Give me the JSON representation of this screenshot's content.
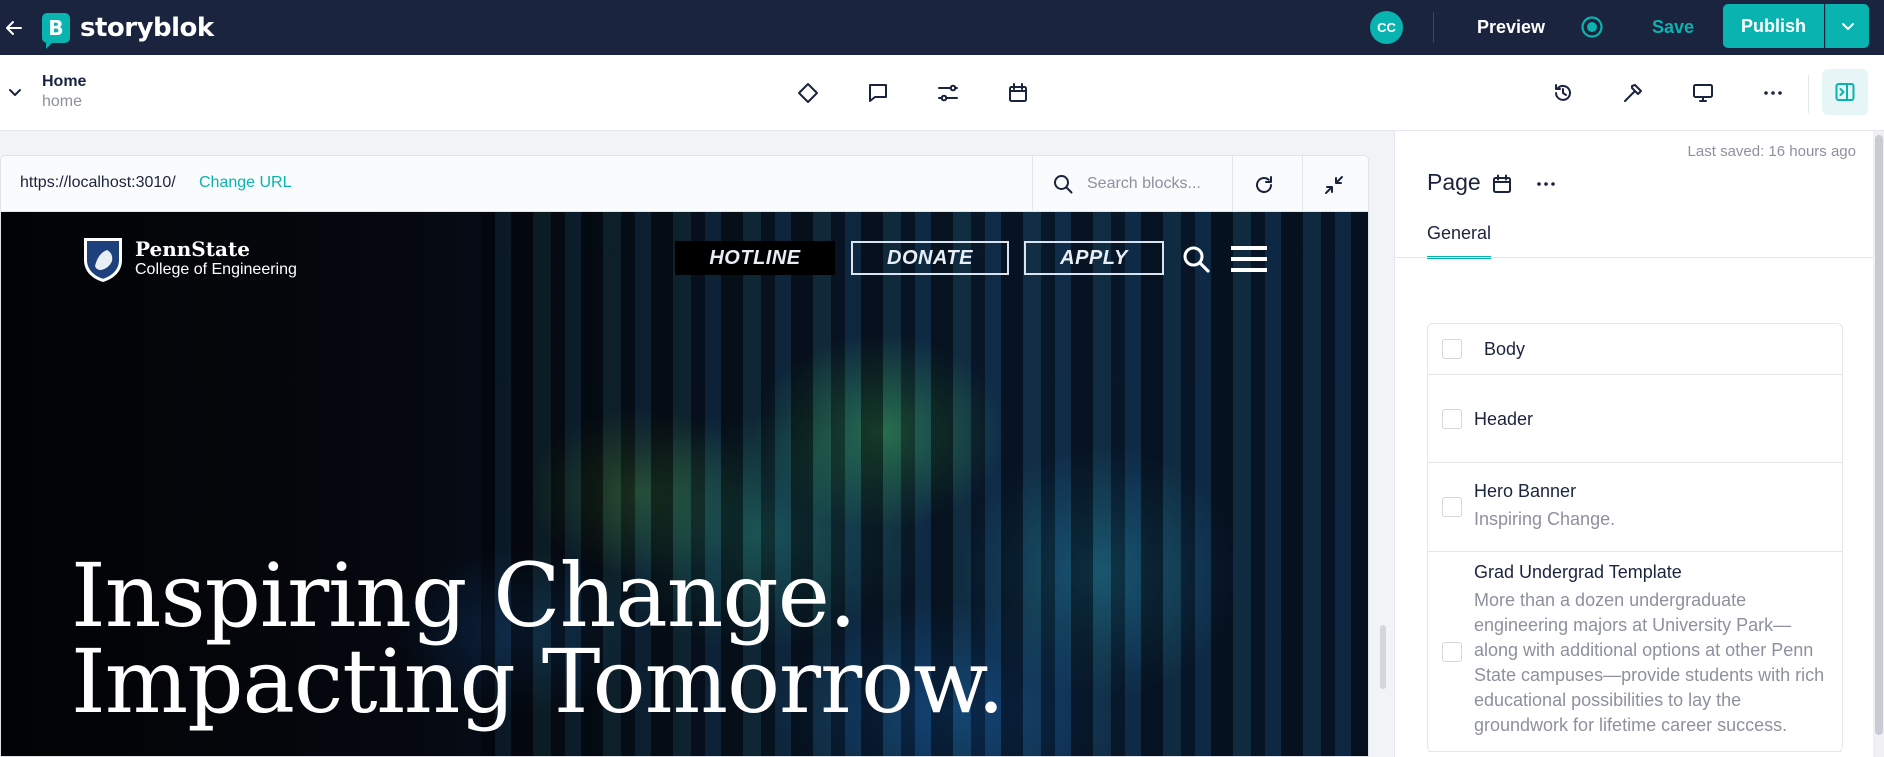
{
  "app": {
    "brand_name": "storyblok",
    "brand_initial": "B",
    "accent_color": "#09b3af",
    "topbar_color": "#1b243f"
  },
  "topbar": {
    "avatar_initials": "CC",
    "preview_label": "Preview",
    "save_label": "Save",
    "publish_label": "Publish"
  },
  "story": {
    "title": "Home",
    "slug": "home"
  },
  "toolbar_icons": [
    "component-icon",
    "comment-icon",
    "settings-sliders-icon",
    "calendar-icon"
  ],
  "right_tools": [
    "history-icon",
    "hammer-icon",
    "monitor-icon",
    "more-icon",
    "sidebar-toggle-icon"
  ],
  "preview": {
    "url": "https://localhost:3010/",
    "change_url_label": "Change URL",
    "search_placeholder": "Search blocks..."
  },
  "site": {
    "logo_name": "PennState",
    "logo_subtitle": "College of Engineering",
    "nav": [
      "HOTLINE",
      "DONATE",
      "APPLY"
    ],
    "hero_line1": "Inspiring Change.",
    "hero_line2": "Impacting Tomorrow."
  },
  "panel": {
    "last_saved": "Last saved: 16 hours ago",
    "title": "Page",
    "tab_general": "General",
    "blocks": [
      {
        "name": "Body",
        "desc": ""
      },
      {
        "name": "Header",
        "desc": ""
      },
      {
        "name": "Hero Banner",
        "desc": "Inspiring Change."
      },
      {
        "name": "Grad Undergrad Template",
        "desc": "More than a dozen undergraduate engineering majors at University Park—along with additional options at other Penn State campuses—provide students with rich educational possibilities to lay the groundwork for lifetime career success."
      }
    ]
  }
}
